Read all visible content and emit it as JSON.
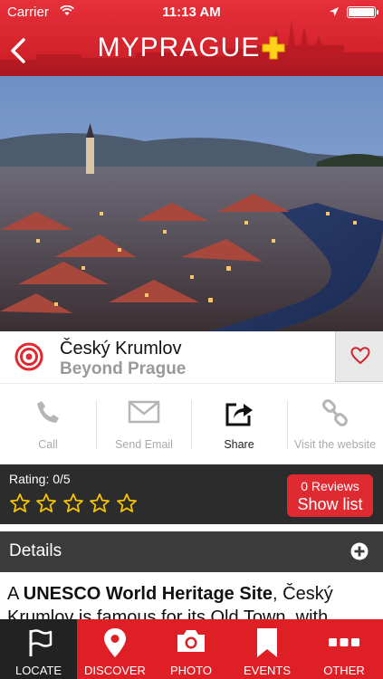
{
  "status_bar": {
    "carrier": "Carrier",
    "time": "11:13 AM"
  },
  "header": {
    "title": "MYPRAGUE"
  },
  "place": {
    "name": "Český Krumlov",
    "category": "Beyond Prague"
  },
  "actions": [
    {
      "label": "Call",
      "icon": "phone-icon",
      "enabled": false
    },
    {
      "label": "Send Email",
      "icon": "envelope-icon",
      "enabled": false
    },
    {
      "label": "Share",
      "icon": "share-icon",
      "enabled": true
    },
    {
      "label": "Visit the website",
      "icon": "link-icon",
      "enabled": false
    }
  ],
  "rating": {
    "label": "Rating: 0/5",
    "stars_filled": 0,
    "stars_total": 5
  },
  "reviews": {
    "count_label": "0 Reviews",
    "button_label": "Show list"
  },
  "details": {
    "title": "Details",
    "text_before": "A ",
    "text_bold": "UNESCO World Heritage Site",
    "text_after": ", Český Krumlov is famous for its Old Town, with"
  },
  "tabs": [
    {
      "label": "LOCATE",
      "icon": "flag-icon",
      "active": true
    },
    {
      "label": "DISCOVER",
      "icon": "map-pin-icon",
      "active": false
    },
    {
      "label": "PHOTO",
      "icon": "camera-icon",
      "active": false
    },
    {
      "label": "EVENTS",
      "icon": "bookmark-icon",
      "active": false
    },
    {
      "label": "OTHER",
      "icon": "more-icon",
      "active": false
    }
  ],
  "colors": {
    "brand_red": "#de1f26",
    "dark_bar": "#2c2c2c",
    "star_yellow": "#f5c400",
    "logo_yellow": "#ffd21a"
  }
}
